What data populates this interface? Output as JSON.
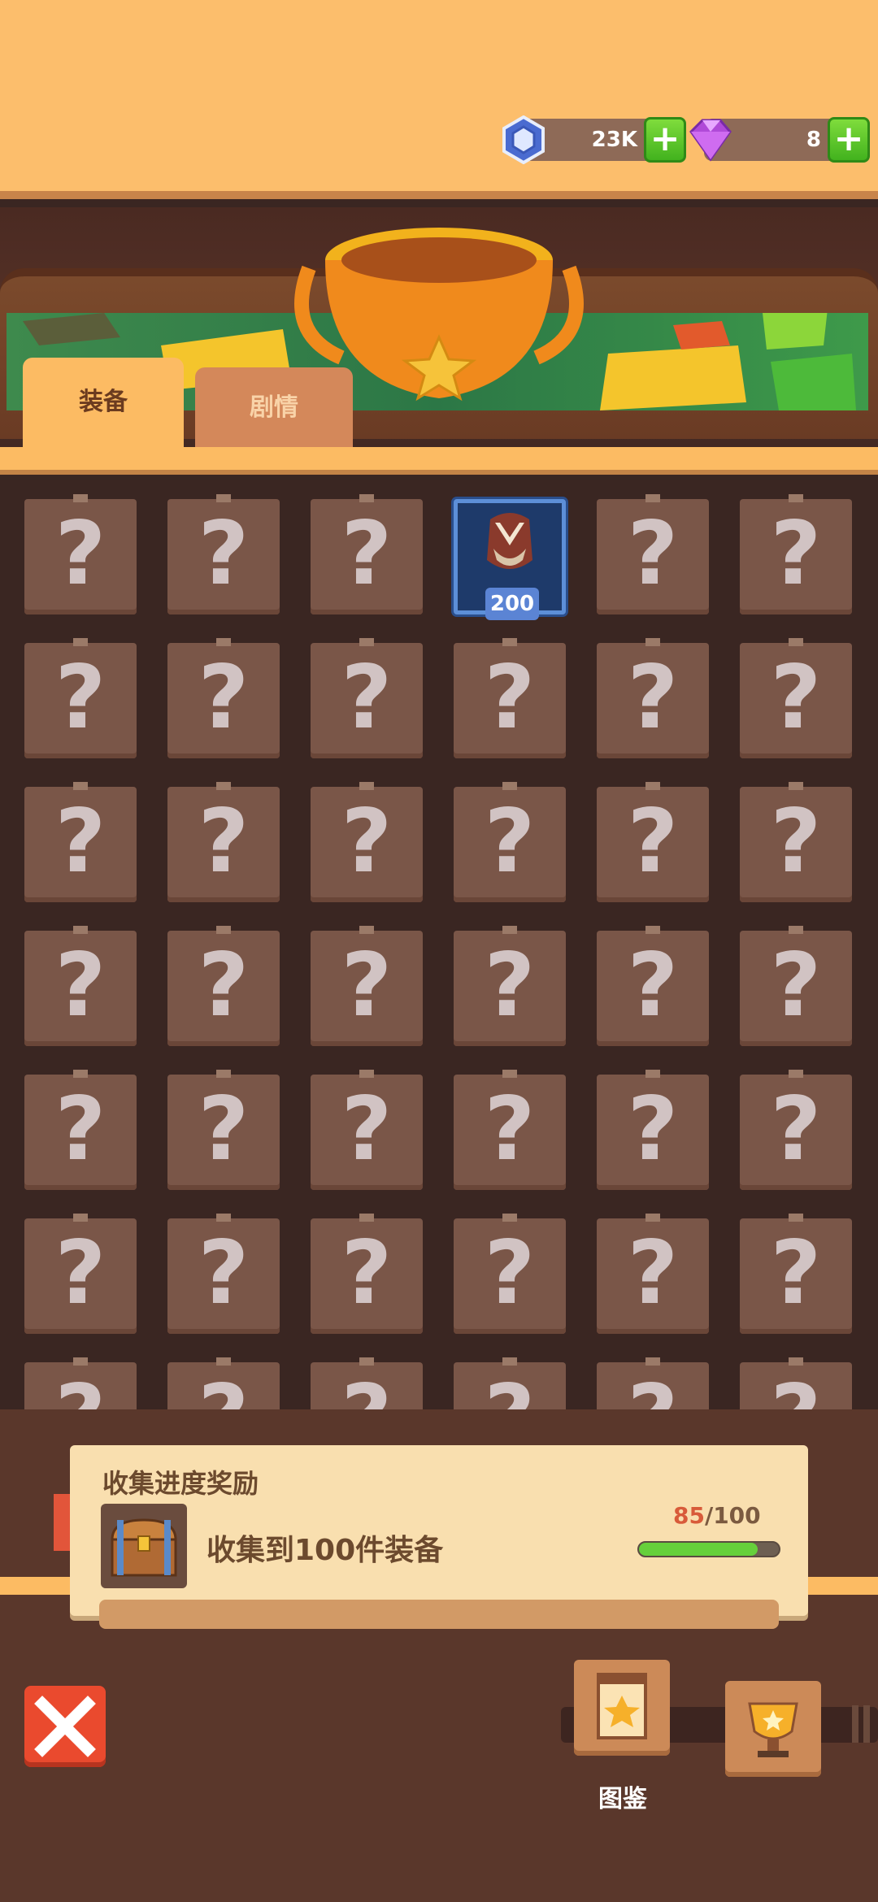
{
  "resources": {
    "coins": {
      "icon": "coin-icon",
      "value": "23K"
    },
    "gems": {
      "icon": "gem-icon",
      "value": "8"
    }
  },
  "tabs": [
    {
      "label": "装备",
      "active": true
    },
    {
      "label": "剧情",
      "active": false
    }
  ],
  "grid": {
    "columns": 6,
    "locked_symbol": "?",
    "unlocked_item": {
      "row": 0,
      "col": 3,
      "badge": "200",
      "icon": "mask-helmet-icon"
    }
  },
  "collection_reward": {
    "title": "收集进度奖励",
    "description": "收集到100件装备",
    "current": "85",
    "total": "/100",
    "progress": 0.85,
    "icon": "treasure-chest-icon"
  },
  "bottom_nav": {
    "close_icon": "close-icon",
    "codex_label": "图鉴",
    "codex_icon": "codex-book-icon",
    "trophy_icon": "trophy-icon"
  },
  "colors": {
    "accent": "#fcbb63",
    "progress": "#66d03b",
    "close": "#ea4a2e",
    "badge": "#5b84d4"
  }
}
